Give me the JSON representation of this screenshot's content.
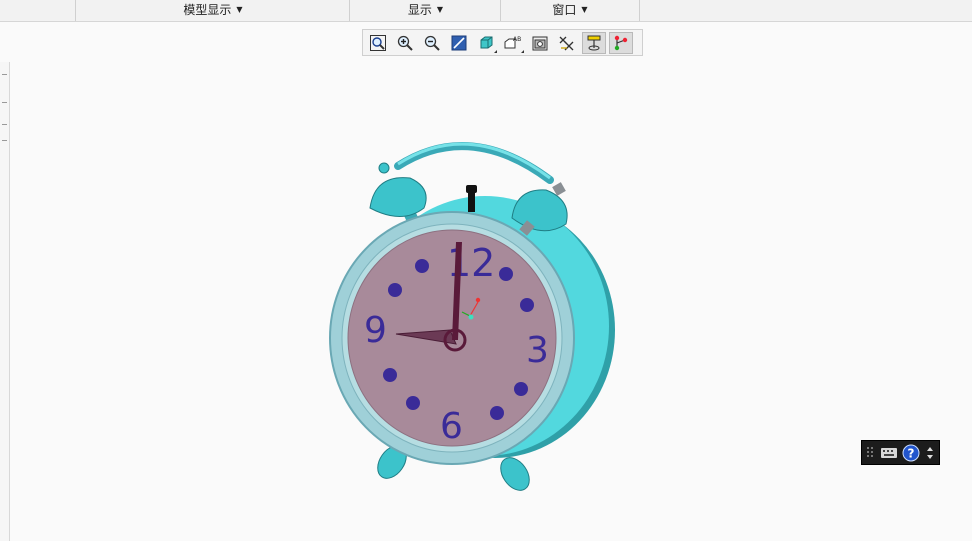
{
  "menubar": {
    "model_display": "模型显示",
    "display": "显示",
    "window": "窗口"
  },
  "toolbar": {
    "buttons": [
      {
        "icon": "refit-icon"
      },
      {
        "icon": "zoom-in-icon"
      },
      {
        "icon": "zoom-out-icon"
      },
      {
        "icon": "repaint-icon"
      },
      {
        "icon": "display-style-icon"
      },
      {
        "icon": "saved-orientations-icon"
      },
      {
        "icon": "view-manager-icon"
      },
      {
        "icon": "datum-display-filters-icon"
      },
      {
        "icon": "spin-center-icon"
      },
      {
        "icon": "annotation-display-icon"
      }
    ]
  },
  "clock": {
    "numerals": {
      "twelve": "12",
      "three": "3",
      "six": "6",
      "nine": "9"
    },
    "colors": {
      "body": "#4fd6dc",
      "face": "#a88a9a",
      "rim": "#9ccfd6",
      "numerals": "#3a2b98",
      "hands": "#5a1a3a"
    }
  },
  "statusbox": {
    "icons": [
      "grip-icon",
      "keyboard-icon",
      "help-icon",
      "scroll-arrows-icon"
    ]
  }
}
